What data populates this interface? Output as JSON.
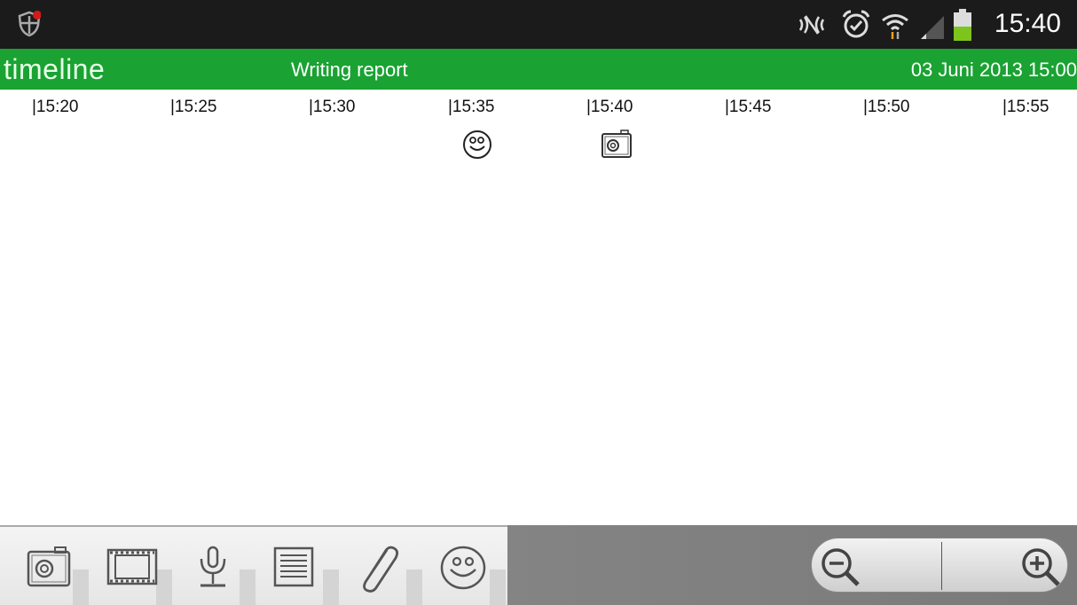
{
  "status_bar": {
    "time": "15:40",
    "icons": [
      "shield-icon",
      "no-signal-icon",
      "alarm-clock-icon",
      "wifi-icon",
      "cell-signal-icon",
      "battery-icon"
    ]
  },
  "app_bar": {
    "logo": "timeline",
    "title": "Writing report",
    "date": "03 Juni 2013 15:00"
  },
  "timeline": {
    "ticks": [
      "|15:20",
      "|15:25",
      "|15:30",
      "|15:35",
      "|15:40",
      "|15:45",
      "|15:50",
      "|15:55"
    ],
    "events": [
      {
        "type": "mood",
        "icon": "smiley-icon",
        "time": "15:35"
      },
      {
        "type": "photo",
        "icon": "camera-icon",
        "time": "15:40"
      }
    ]
  },
  "toolbar": {
    "tools": [
      {
        "name": "photo",
        "icon": "camera-icon"
      },
      {
        "name": "video",
        "icon": "film-icon"
      },
      {
        "name": "audio",
        "icon": "microphone-icon"
      },
      {
        "name": "text",
        "icon": "notes-icon"
      },
      {
        "name": "attachment",
        "icon": "paperclip-icon"
      },
      {
        "name": "mood",
        "icon": "smiley-icon"
      }
    ],
    "zoom": [
      "zoom-out-icon",
      "zoom-in-icon"
    ]
  },
  "colors": {
    "status_bar": "#1b1b1b",
    "app_bar": "#1aa233",
    "battery": "#7dc41d"
  }
}
